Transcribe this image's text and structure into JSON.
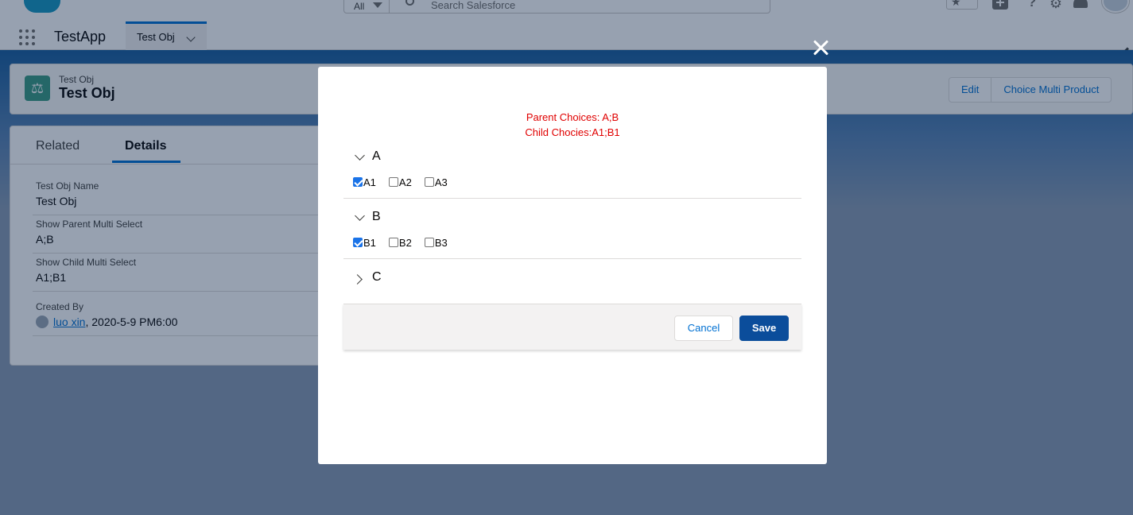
{
  "header": {
    "search_scope": "All",
    "search_placeholder": "Search Salesforce"
  },
  "nav": {
    "app_name": "TestApp",
    "tab_label": "Test Obj"
  },
  "record": {
    "object_type": "Test Obj",
    "record_name": "Test Obj",
    "actions": [
      "Edit",
      "Choice Multi Product"
    ]
  },
  "detail": {
    "tabs": [
      "Related",
      "Details"
    ],
    "active_tab": "Details",
    "fields": [
      {
        "label": "Test Obj Name",
        "value": "Test Obj"
      },
      {
        "label": "Show Parent Multi Select",
        "value": "A;B"
      },
      {
        "label": "Show Child Multi Select",
        "value": "A1;B1"
      }
    ],
    "created_by": {
      "label": "Created By",
      "user": "luo xin",
      "date": ", 2020-5-9 PM6:00"
    }
  },
  "modal": {
    "summary_parent": "Parent Choices: A;B",
    "summary_child": "Child Chocies:A1;B1",
    "sections": [
      {
        "title": "A",
        "expanded": true,
        "options": [
          {
            "label": "A1",
            "checked": true
          },
          {
            "label": "A2",
            "checked": false
          },
          {
            "label": "A3",
            "checked": false
          }
        ]
      },
      {
        "title": "B",
        "expanded": true,
        "options": [
          {
            "label": "B1",
            "checked": true
          },
          {
            "label": "B2",
            "checked": false
          },
          {
            "label": "B3",
            "checked": false
          }
        ]
      },
      {
        "title": "C",
        "expanded": false,
        "options": []
      }
    ],
    "cancel_label": "Cancel",
    "save_label": "Save"
  },
  "colors": {
    "brand_blue": "#0070d2",
    "save_button": "#0b4d9b",
    "summary_text": "#e00000",
    "object_icon": "#3c9c84",
    "checkbox_checked": "#1a73e8"
  },
  "icons": {
    "close": "close-icon",
    "expanded": "chevron-down-icon",
    "collapsed": "chevron-right-icon",
    "object": "scales-icon",
    "app_launcher": "waffle-icon"
  }
}
